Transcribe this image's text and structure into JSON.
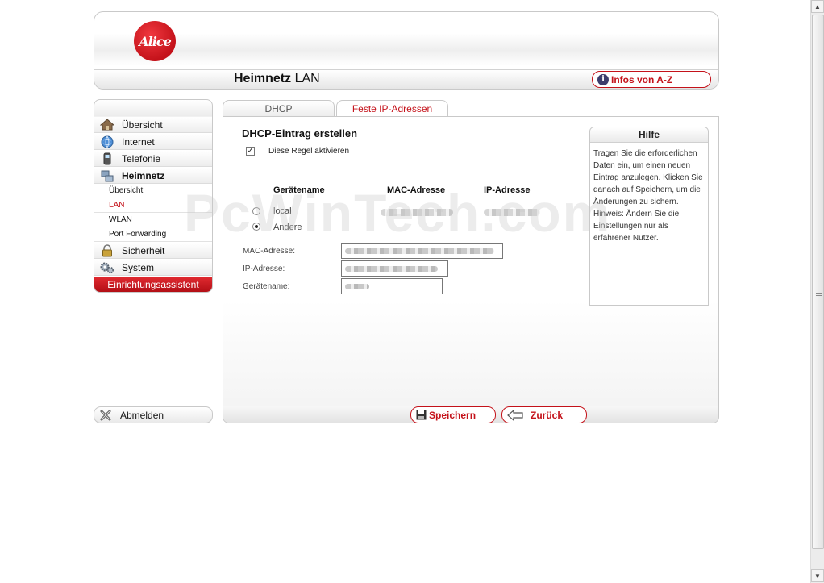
{
  "header": {
    "logo_text": "Alice",
    "title_bold": "Heimnetz",
    "title_sub": "LAN",
    "infos_button": "Infos von A-Z",
    "infos_icon": "i"
  },
  "sidebar": {
    "items": [
      {
        "label": "Übersicht",
        "icon": "house-icon"
      },
      {
        "label": "Internet",
        "icon": "globe-icon"
      },
      {
        "label": "Telefonie",
        "icon": "phone-icon"
      },
      {
        "label": "Heimnetz",
        "icon": "network-icon"
      },
      {
        "label": "Sicherheit",
        "icon": "lock-icon"
      },
      {
        "label": "System",
        "icon": "gears-icon"
      }
    ],
    "subitems": [
      "Übersicht",
      "LAN",
      "WLAN",
      "Port Forwarding"
    ],
    "wizard": "Einrichtungsassistent",
    "logout": "Abmelden"
  },
  "tabs": [
    "DHCP",
    "Feste IP-Adressen"
  ],
  "form": {
    "title": "DHCP-Eintrag erstellen",
    "checkbox_label": "Diese Regel aktivieren",
    "checkbox_mark": "✓",
    "columns": [
      "Gerätename",
      "MAC-Adresse",
      "IP-Adresse"
    ],
    "radio_local": "local",
    "radio_other": "Andere",
    "mac_label": "MAC-Adresse:",
    "ip_label": "IP-Adresse:",
    "name_label": "Gerätename:"
  },
  "help": {
    "title": "Hilfe",
    "text": "Tragen Sie die erforderlichen Daten ein, um einen neuen Eintrag anzulegen. Klicken Sie danach auf Speichern, um die Änderungen zu sichern. Hinweis: Ändern Sie die Einstellungen nur als erfahrener Nutzer."
  },
  "footer": {
    "save": "Speichern",
    "back": "Zurück"
  },
  "watermark": "PcWinTech.com",
  "colors": {
    "brand_red": "#c4121a"
  }
}
